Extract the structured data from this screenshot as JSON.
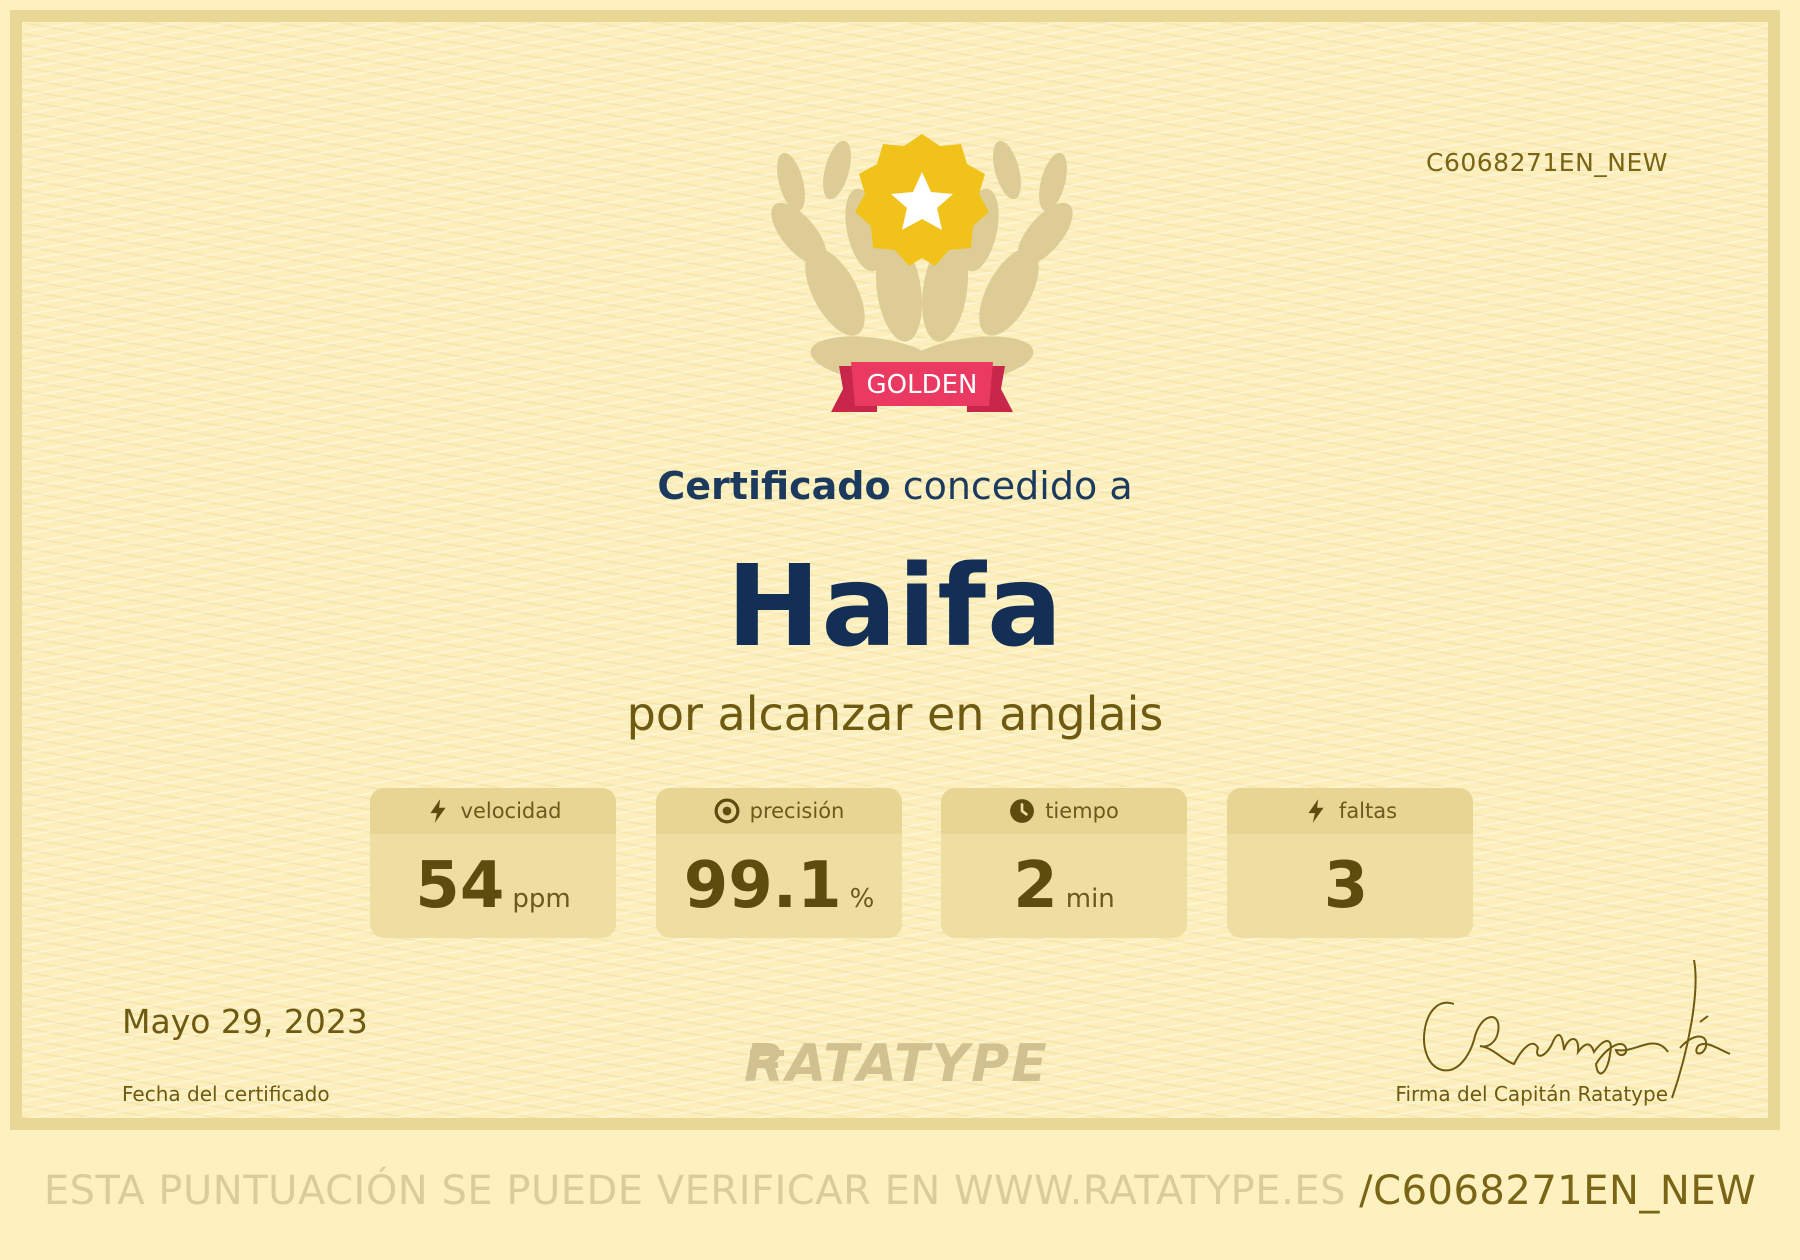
{
  "certificate": {
    "id": "C6068271EN_NEW",
    "badge_label": "GOLDEN",
    "heading_bold": "Certificado",
    "heading_rest": " concedido a",
    "recipient_name": "Haifa",
    "subtitle": "por alcanzar en anglais"
  },
  "stats": [
    {
      "label": "velocidad",
      "icon": "lightning-icon",
      "value": "54",
      "unit": "ppm"
    },
    {
      "label": "precisión",
      "icon": "target-icon",
      "value": "99.1",
      "unit": "%"
    },
    {
      "label": "tiempo",
      "icon": "clock-icon",
      "value": "2",
      "unit": "min"
    },
    {
      "label": "faltas",
      "icon": "lightning-icon",
      "value": "3",
      "unit": ""
    }
  ],
  "footer": {
    "date": "Mayo 29, 2023",
    "date_label": "Fecha del certificado",
    "logo_text": "RATATYPE",
    "signature_label": "Firma del Capitán Ratatype"
  },
  "verify": {
    "prefix": "ESTA PUNTUACIÓN SE PUEDE VERIFICAR EN WWW.RATATYPE.ES ",
    "code": "/C6068271EN_NEW"
  },
  "colors": {
    "background": "#fcefbb",
    "navy": "#142f55",
    "gold_text": "#6f5a12",
    "badge_gold": "#f0c21a",
    "ribbon_red": "#e8355d"
  }
}
